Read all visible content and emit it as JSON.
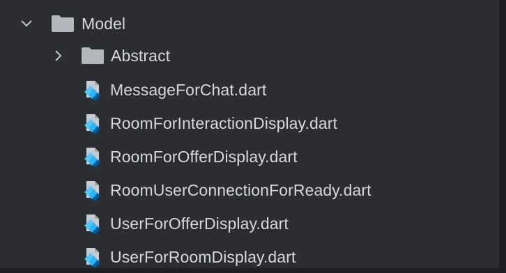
{
  "project_tree": {
    "root_folder": {
      "label": "Model",
      "expanded": true,
      "icon": "folder-icon",
      "chevron": "chevron-down-icon"
    },
    "subfolder": {
      "label": "Abstract",
      "expanded": false,
      "icon": "folder-icon",
      "chevron": "chevron-right-icon"
    },
    "files": [
      {
        "label": "MessageForChat.dart",
        "icon": "dart-file-icon"
      },
      {
        "label": "RoomForInteractionDisplay.dart",
        "icon": "dart-file-icon"
      },
      {
        "label": "RoomForOfferDisplay.dart",
        "icon": "dart-file-icon"
      },
      {
        "label": "RoomUserConnectionForReady.dart",
        "icon": "dart-file-icon"
      },
      {
        "label": "UserForOfferDisplay.dart",
        "icon": "dart-file-icon"
      },
      {
        "label": "UserForRoomDisplay.dart",
        "icon": "dart-file-icon"
      }
    ]
  },
  "colors": {
    "panel_background": "#2b2d30",
    "frame_edge": "#1e1f22",
    "text": "#d6d8dc",
    "folder": "#b4b7bd",
    "dart_light_blue": "#54c5f8",
    "dart_mid_blue": "#29b6f6",
    "dart_dark_blue": "#01579b",
    "file_page": "#c8ccd2"
  }
}
